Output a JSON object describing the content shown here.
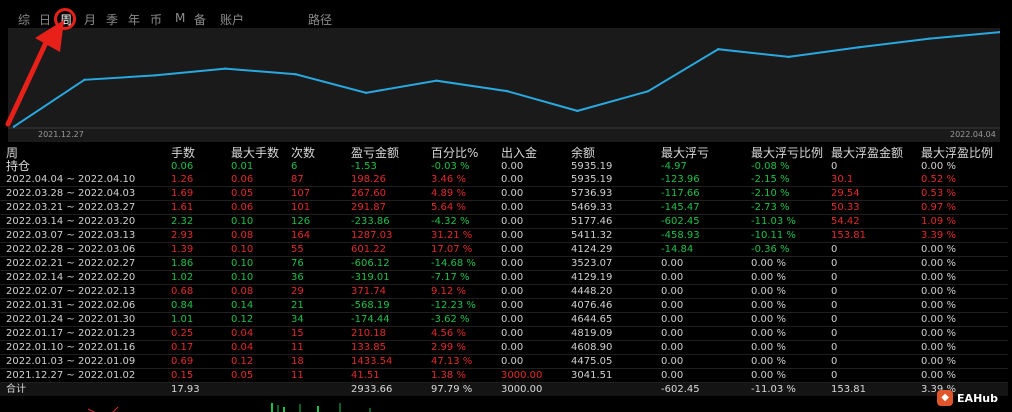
{
  "tabs": [
    {
      "label": "综"
    },
    {
      "label": "日"
    },
    {
      "label": "周"
    },
    {
      "label": "月"
    },
    {
      "label": "季"
    },
    {
      "label": "年"
    },
    {
      "label": "币"
    },
    {
      "label": "M"
    },
    {
      "label": "备"
    },
    {
      "label": "账户"
    },
    {
      "label": "路径"
    }
  ],
  "active_tab": "周",
  "chart": {
    "start_date": "2021.12.27",
    "end_date": "2022.04.04",
    "line_color": "#29a8e0"
  },
  "chart_data": {
    "type": "line",
    "x": [
      "2021.12.27",
      "2022.01.03",
      "2022.01.10",
      "2022.01.17",
      "2022.01.24",
      "2022.01.31",
      "2022.02.07",
      "2022.02.14",
      "2022.02.21",
      "2022.02.28",
      "2022.03.07",
      "2022.03.14",
      "2022.03.21",
      "2022.03.28",
      "2022.04.04"
    ],
    "series": [
      {
        "values": [
          3041.51,
          4475.05,
          4608.9,
          4819.09,
          4644.65,
          4076.46,
          4448.2,
          4129.19,
          3523.07,
          4124.29,
          5411.32,
          5177.46,
          5469.33,
          5736.93,
          5935.19
        ]
      }
    ]
  },
  "table": {
    "headers": [
      "周",
      "手数",
      "最大手数",
      "次数",
      "盈亏金额",
      "百分比%",
      "出入金",
      "余额",
      "最大浮亏",
      "最大浮亏比例",
      "最大浮盈金额",
      "最大浮盈比例"
    ],
    "holding": {
      "cells": [
        {
          "t": "持仓",
          "c": "w"
        },
        {
          "t": "0.06",
          "c": "g"
        },
        {
          "t": "0.01",
          "c": "g"
        },
        {
          "t": "6",
          "c": "g"
        },
        {
          "t": "-1.53",
          "c": "g"
        },
        {
          "t": "-0.03 %",
          "c": "g"
        },
        {
          "t": "0.00",
          "c": "w"
        },
        {
          "t": "5935.19",
          "c": "w"
        },
        {
          "t": "-4.97",
          "c": "g"
        },
        {
          "t": "-0.08 %",
          "c": "g"
        },
        {
          "t": "0",
          "c": "w"
        },
        {
          "t": "0.00 %",
          "c": "w"
        }
      ]
    },
    "rows": [
      {
        "cells": [
          {
            "t": "2022.04.04 ~ 2022.04.10",
            "c": "w"
          },
          {
            "t": "1.26",
            "c": "r"
          },
          {
            "t": "0.06",
            "c": "r"
          },
          {
            "t": "87",
            "c": "r"
          },
          {
            "t": "198.26",
            "c": "r"
          },
          {
            "t": "3.46 %",
            "c": "r"
          },
          {
            "t": "0.00",
            "c": "w"
          },
          {
            "t": "5935.19",
            "c": "w"
          },
          {
            "t": "-123.96",
            "c": "g"
          },
          {
            "t": "-2.15 %",
            "c": "g"
          },
          {
            "t": "30.1",
            "c": "r"
          },
          {
            "t": "0.52 %",
            "c": "r"
          }
        ]
      },
      {
        "cells": [
          {
            "t": "2022.03.28 ~ 2022.04.03",
            "c": "w"
          },
          {
            "t": "1.69",
            "c": "r"
          },
          {
            "t": "0.05",
            "c": "r"
          },
          {
            "t": "107",
            "c": "r"
          },
          {
            "t": "267.60",
            "c": "r"
          },
          {
            "t": "4.89 %",
            "c": "r"
          },
          {
            "t": "0.00",
            "c": "w"
          },
          {
            "t": "5736.93",
            "c": "w"
          },
          {
            "t": "-117.66",
            "c": "g"
          },
          {
            "t": "-2.10 %",
            "c": "g"
          },
          {
            "t": "29.54",
            "c": "r"
          },
          {
            "t": "0.53 %",
            "c": "r"
          }
        ]
      },
      {
        "cells": [
          {
            "t": "2022.03.21 ~ 2022.03.27",
            "c": "w"
          },
          {
            "t": "1.61",
            "c": "r"
          },
          {
            "t": "0.06",
            "c": "r"
          },
          {
            "t": "101",
            "c": "r"
          },
          {
            "t": "291.87",
            "c": "r"
          },
          {
            "t": "5.64 %",
            "c": "r"
          },
          {
            "t": "0.00",
            "c": "w"
          },
          {
            "t": "5469.33",
            "c": "w"
          },
          {
            "t": "-145.47",
            "c": "g"
          },
          {
            "t": "-2.73 %",
            "c": "g"
          },
          {
            "t": "50.33",
            "c": "r"
          },
          {
            "t": "0.97 %",
            "c": "r"
          }
        ]
      },
      {
        "cells": [
          {
            "t": "2022.03.14 ~ 2022.03.20",
            "c": "w"
          },
          {
            "t": "2.32",
            "c": "g"
          },
          {
            "t": "0.10",
            "c": "g"
          },
          {
            "t": "126",
            "c": "g"
          },
          {
            "t": "-233.86",
            "c": "g"
          },
          {
            "t": "-4.32 %",
            "c": "g"
          },
          {
            "t": "0.00",
            "c": "w"
          },
          {
            "t": "5177.46",
            "c": "w"
          },
          {
            "t": "-602.45",
            "c": "g"
          },
          {
            "t": "-11.03 %",
            "c": "g"
          },
          {
            "t": "54.42",
            "c": "r"
          },
          {
            "t": "1.09 %",
            "c": "r"
          }
        ]
      },
      {
        "cells": [
          {
            "t": "2022.03.07 ~ 2022.03.13",
            "c": "w"
          },
          {
            "t": "2.93",
            "c": "r"
          },
          {
            "t": "0.08",
            "c": "r"
          },
          {
            "t": "164",
            "c": "r"
          },
          {
            "t": "1287.03",
            "c": "r"
          },
          {
            "t": "31.21 %",
            "c": "r"
          },
          {
            "t": "0.00",
            "c": "w"
          },
          {
            "t": "5411.32",
            "c": "w"
          },
          {
            "t": "-458.93",
            "c": "g"
          },
          {
            "t": "-10.11 %",
            "c": "g"
          },
          {
            "t": "153.81",
            "c": "r"
          },
          {
            "t": "3.39 %",
            "c": "r"
          }
        ]
      },
      {
        "cells": [
          {
            "t": "2022.02.28 ~ 2022.03.06",
            "c": "w"
          },
          {
            "t": "1.39",
            "c": "r"
          },
          {
            "t": "0.10",
            "c": "r"
          },
          {
            "t": "55",
            "c": "r"
          },
          {
            "t": "601.22",
            "c": "r"
          },
          {
            "t": "17.07 %",
            "c": "r"
          },
          {
            "t": "0.00",
            "c": "w"
          },
          {
            "t": "4124.29",
            "c": "w"
          },
          {
            "t": "-14.84",
            "c": "g"
          },
          {
            "t": "-0.36 %",
            "c": "g"
          },
          {
            "t": "0",
            "c": "w"
          },
          {
            "t": "0.00 %",
            "c": "w"
          }
        ]
      },
      {
        "cells": [
          {
            "t": "2022.02.21 ~ 2022.02.27",
            "c": "w"
          },
          {
            "t": "1.86",
            "c": "g"
          },
          {
            "t": "0.10",
            "c": "g"
          },
          {
            "t": "76",
            "c": "g"
          },
          {
            "t": "-606.12",
            "c": "g"
          },
          {
            "t": "-14.68 %",
            "c": "g"
          },
          {
            "t": "0.00",
            "c": "w"
          },
          {
            "t": "3523.07",
            "c": "w"
          },
          {
            "t": "0.00",
            "c": "w"
          },
          {
            "t": "0.00 %",
            "c": "w"
          },
          {
            "t": "0",
            "c": "w"
          },
          {
            "t": "0.00 %",
            "c": "w"
          }
        ]
      },
      {
        "cells": [
          {
            "t": "2022.02.14 ~ 2022.02.20",
            "c": "w"
          },
          {
            "t": "1.02",
            "c": "g"
          },
          {
            "t": "0.10",
            "c": "g"
          },
          {
            "t": "36",
            "c": "g"
          },
          {
            "t": "-319.01",
            "c": "g"
          },
          {
            "t": "-7.17 %",
            "c": "g"
          },
          {
            "t": "0.00",
            "c": "w"
          },
          {
            "t": "4129.19",
            "c": "w"
          },
          {
            "t": "0.00",
            "c": "w"
          },
          {
            "t": "0.00 %",
            "c": "w"
          },
          {
            "t": "0",
            "c": "w"
          },
          {
            "t": "0.00 %",
            "c": "w"
          }
        ]
      },
      {
        "cells": [
          {
            "t": "2022.02.07 ~ 2022.02.13",
            "c": "w"
          },
          {
            "t": "0.68",
            "c": "r"
          },
          {
            "t": "0.08",
            "c": "r"
          },
          {
            "t": "29",
            "c": "r"
          },
          {
            "t": "371.74",
            "c": "r"
          },
          {
            "t": "9.12 %",
            "c": "r"
          },
          {
            "t": "0.00",
            "c": "w"
          },
          {
            "t": "4448.20",
            "c": "w"
          },
          {
            "t": "0.00",
            "c": "w"
          },
          {
            "t": "0.00 %",
            "c": "w"
          },
          {
            "t": "0",
            "c": "w"
          },
          {
            "t": "0.00 %",
            "c": "w"
          }
        ]
      },
      {
        "cells": [
          {
            "t": "2022.01.31 ~ 2022.02.06",
            "c": "w"
          },
          {
            "t": "0.84",
            "c": "g"
          },
          {
            "t": "0.14",
            "c": "g"
          },
          {
            "t": "21",
            "c": "g"
          },
          {
            "t": "-568.19",
            "c": "g"
          },
          {
            "t": "-12.23 %",
            "c": "g"
          },
          {
            "t": "0.00",
            "c": "w"
          },
          {
            "t": "4076.46",
            "c": "w"
          },
          {
            "t": "0.00",
            "c": "w"
          },
          {
            "t": "0.00 %",
            "c": "w"
          },
          {
            "t": "0",
            "c": "w"
          },
          {
            "t": "0.00 %",
            "c": "w"
          }
        ]
      },
      {
        "cells": [
          {
            "t": "2022.01.24 ~ 2022.01.30",
            "c": "w"
          },
          {
            "t": "1.01",
            "c": "g"
          },
          {
            "t": "0.12",
            "c": "g"
          },
          {
            "t": "34",
            "c": "g"
          },
          {
            "t": "-174.44",
            "c": "g"
          },
          {
            "t": "-3.62 %",
            "c": "g"
          },
          {
            "t": "0.00",
            "c": "w"
          },
          {
            "t": "4644.65",
            "c": "w"
          },
          {
            "t": "0.00",
            "c": "w"
          },
          {
            "t": "0.00 %",
            "c": "w"
          },
          {
            "t": "0",
            "c": "w"
          },
          {
            "t": "0.00 %",
            "c": "w"
          }
        ]
      },
      {
        "cells": [
          {
            "t": "2022.01.17 ~ 2022.01.23",
            "c": "w"
          },
          {
            "t": "0.25",
            "c": "r"
          },
          {
            "t": "0.04",
            "c": "r"
          },
          {
            "t": "15",
            "c": "r"
          },
          {
            "t": "210.18",
            "c": "r"
          },
          {
            "t": "4.56 %",
            "c": "r"
          },
          {
            "t": "0.00",
            "c": "w"
          },
          {
            "t": "4819.09",
            "c": "w"
          },
          {
            "t": "0.00",
            "c": "w"
          },
          {
            "t": "0.00 %",
            "c": "w"
          },
          {
            "t": "0",
            "c": "w"
          },
          {
            "t": "0.00 %",
            "c": "w"
          }
        ]
      },
      {
        "cells": [
          {
            "t": "2022.01.10 ~ 2022.01.16",
            "c": "w"
          },
          {
            "t": "0.17",
            "c": "r"
          },
          {
            "t": "0.04",
            "c": "r"
          },
          {
            "t": "11",
            "c": "r"
          },
          {
            "t": "133.85",
            "c": "r"
          },
          {
            "t": "2.99 %",
            "c": "r"
          },
          {
            "t": "0.00",
            "c": "w"
          },
          {
            "t": "4608.90",
            "c": "w"
          },
          {
            "t": "0.00",
            "c": "w"
          },
          {
            "t": "0.00 %",
            "c": "w"
          },
          {
            "t": "0",
            "c": "w"
          },
          {
            "t": "0.00 %",
            "c": "w"
          }
        ]
      },
      {
        "cells": [
          {
            "t": "2022.01.03 ~ 2022.01.09",
            "c": "w"
          },
          {
            "t": "0.69",
            "c": "r"
          },
          {
            "t": "0.12",
            "c": "r"
          },
          {
            "t": "18",
            "c": "r"
          },
          {
            "t": "1433.54",
            "c": "r"
          },
          {
            "t": "47.13 %",
            "c": "r"
          },
          {
            "t": "0.00",
            "c": "w"
          },
          {
            "t": "4475.05",
            "c": "w"
          },
          {
            "t": "0.00",
            "c": "w"
          },
          {
            "t": "0.00 %",
            "c": "w"
          },
          {
            "t": "0",
            "c": "w"
          },
          {
            "t": "0.00 %",
            "c": "w"
          }
        ]
      },
      {
        "cells": [
          {
            "t": "2021.12.27 ~ 2022.01.02",
            "c": "w"
          },
          {
            "t": "0.15",
            "c": "r"
          },
          {
            "t": "0.05",
            "c": "r"
          },
          {
            "t": "11",
            "c": "r"
          },
          {
            "t": "41.51",
            "c": "r"
          },
          {
            "t": "1.38 %",
            "c": "r"
          },
          {
            "t": "3000.00",
            "c": "r"
          },
          {
            "t": "3041.51",
            "c": "w"
          },
          {
            "t": "0.00",
            "c": "w"
          },
          {
            "t": "0.00 %",
            "c": "w"
          },
          {
            "t": "0",
            "c": "w"
          },
          {
            "t": "0.00 %",
            "c": "w"
          }
        ]
      }
    ],
    "total": {
      "cells": [
        {
          "t": "合计",
          "c": "w"
        },
        {
          "t": "17.93",
          "c": "r"
        },
        {
          "t": "",
          "c": "w"
        },
        {
          "t": "",
          "c": "w"
        },
        {
          "t": "2933.66",
          "c": "r"
        },
        {
          "t": "97.79 %",
          "c": "r"
        },
        {
          "t": "3000.00",
          "c": "r"
        },
        {
          "t": "",
          "c": "w"
        },
        {
          "t": "-602.45",
          "c": "g"
        },
        {
          "t": "-11.03 %",
          "c": "g"
        },
        {
          "t": "153.81",
          "c": "r"
        },
        {
          "t": "3.39 %",
          "c": "r"
        }
      ]
    }
  },
  "watermark": {
    "text": "EAHub"
  },
  "colors": {
    "positive": "#e02a2a",
    "negative": "#19c04a",
    "neutral": "#d0d0d0",
    "highlight": "#e8201a"
  }
}
